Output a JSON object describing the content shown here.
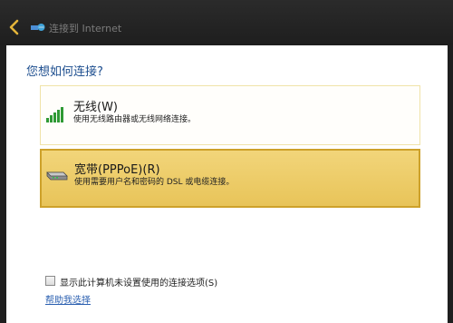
{
  "window": {
    "title": "连接到 Internet",
    "back_icon": "back-arrow-icon",
    "title_icon": "network-globe-icon",
    "accent_color": "#e3b43a"
  },
  "main": {
    "question": "您想如何连接?",
    "options": [
      {
        "title": "无线(W)",
        "description": "使用无线路由器或无线网络连接。",
        "icon": "wireless-signal-icon",
        "selected": false
      },
      {
        "title": "宽带(PPPoE)(R)",
        "description": "使用需要用户名和密码的 DSL 或电缆连接。",
        "icon": "broadband-modem-icon",
        "selected": true
      }
    ],
    "show_unconfigured_checkbox": {
      "label": "显示此计算机未设置使用的连接选项(S)",
      "checked": false
    },
    "help_link": "帮助我选择"
  }
}
